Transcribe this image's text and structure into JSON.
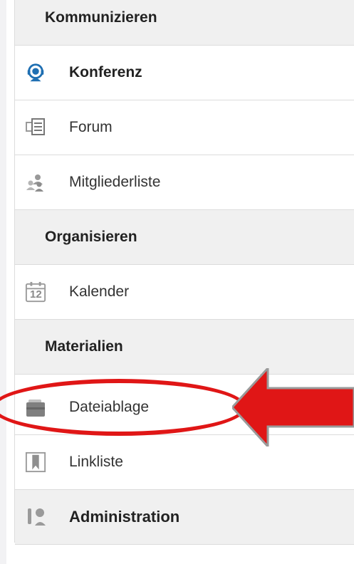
{
  "sidebar": {
    "sections": [
      {
        "title": "Kommunizieren"
      },
      {
        "title": "Organisieren"
      },
      {
        "title": "Materialien"
      },
      {
        "title": "Administration"
      }
    ],
    "items": {
      "konferenz": {
        "label": "Konferenz",
        "icon": "headset-icon",
        "active": true
      },
      "forum": {
        "label": "Forum",
        "icon": "forum-icon"
      },
      "mitglieder": {
        "label": "Mitgliederliste",
        "icon": "members-icon"
      },
      "kalender": {
        "label": "Kalender",
        "icon": "calendar-icon",
        "icon_text": "12"
      },
      "dateiablage": {
        "label": "Dateiablage",
        "icon": "briefcase-icon"
      },
      "linkliste": {
        "label": "Linkliste",
        "icon": "bookmark-icon"
      }
    },
    "admin_icon": "tools-icon"
  },
  "annotation": {
    "color": "#e01616",
    "type": "red arrow pointing to Dateiablage with ellipse highlight"
  },
  "colors": {
    "accent_blue": "#1f6fb2",
    "icon_gray": "#9a9a9a",
    "header_bg": "#f0f0f0"
  }
}
